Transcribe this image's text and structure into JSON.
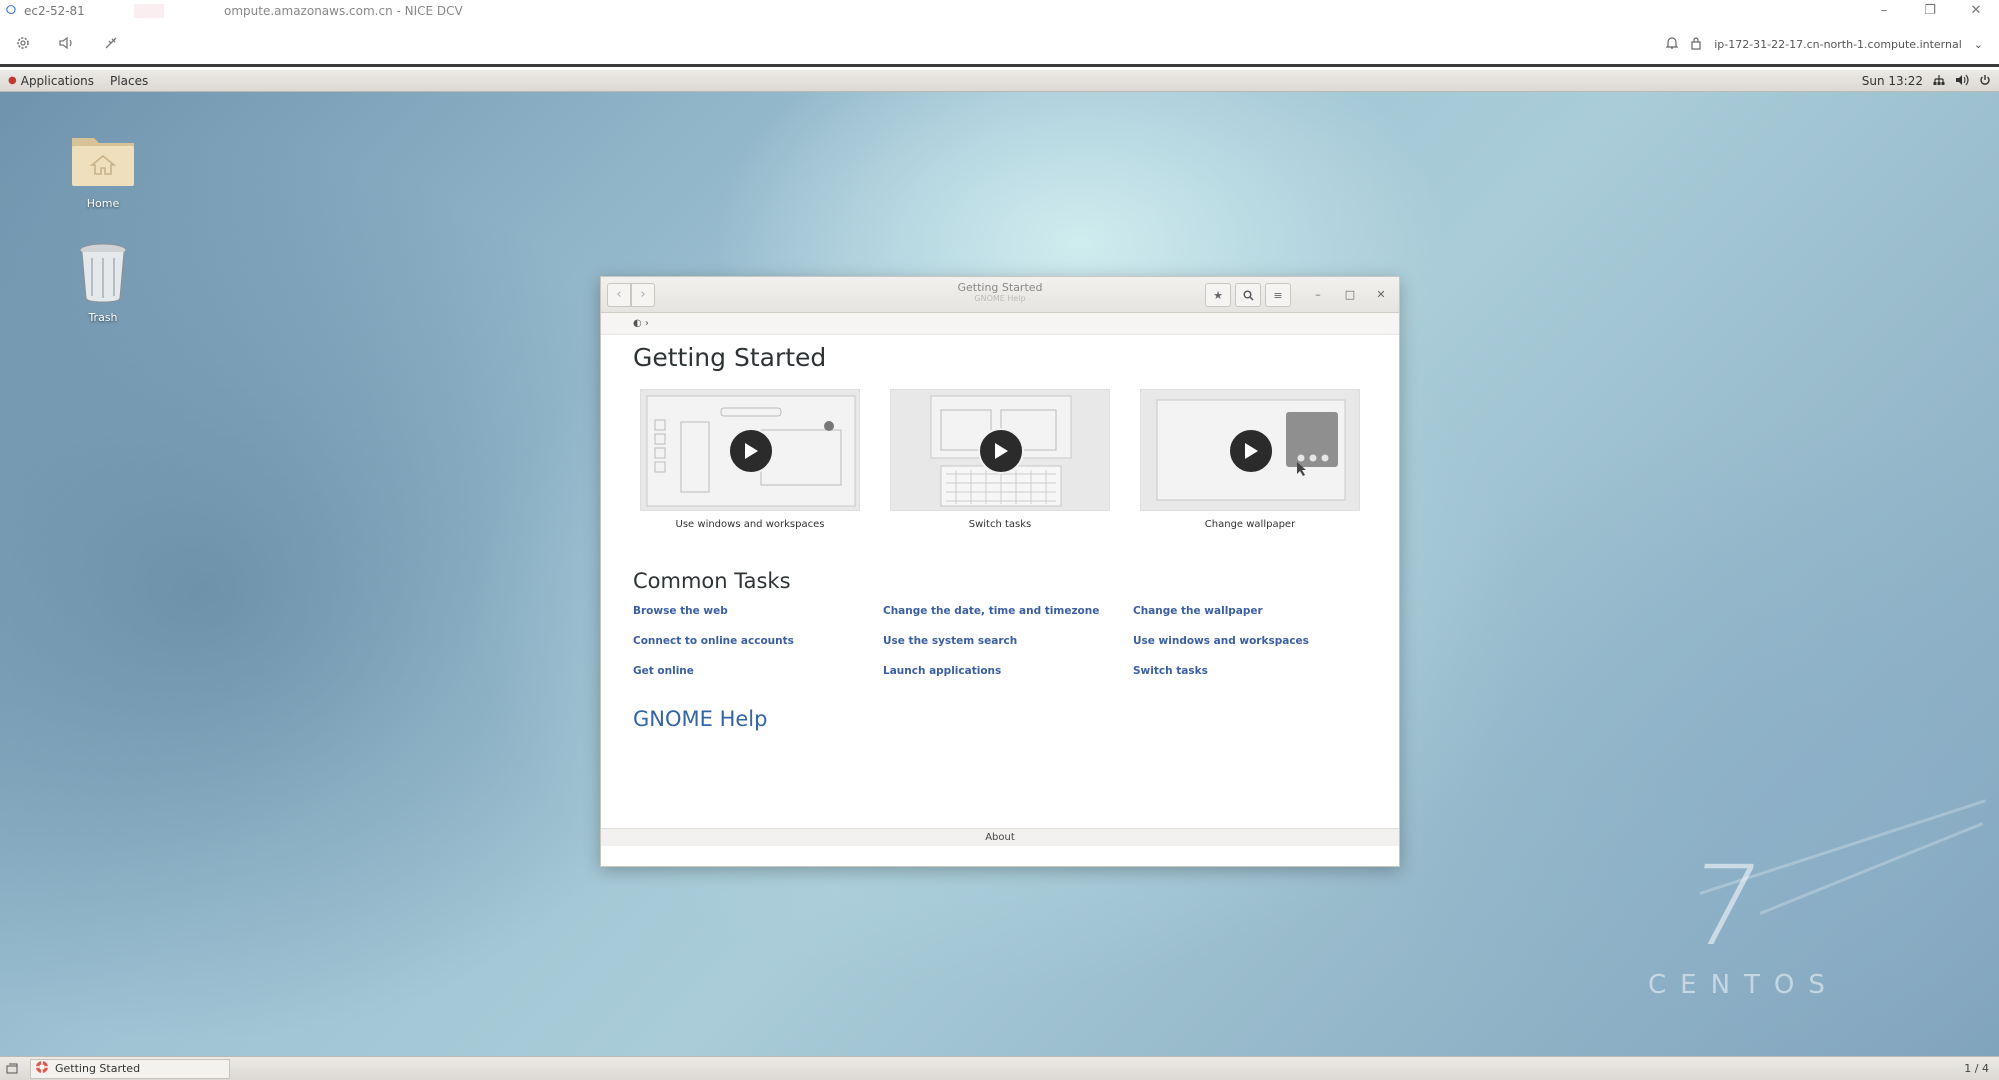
{
  "dcv_client": {
    "tab_label": "ec2-52-81",
    "window_title": "ompute.amazonaws.com.cn - NICE DCV",
    "hostname": "ip-172-31-22-17.cn-north-1.compute.internal"
  },
  "gnome_panel": {
    "applications_label": "Applications",
    "places_label": "Places",
    "clock": "Sun 13:22"
  },
  "desktop": {
    "icons": [
      {
        "label": "Home",
        "icon": "home-folder-icon"
      },
      {
        "label": "Trash",
        "icon": "trash-icon"
      }
    ],
    "watermark_number": "7",
    "watermark_text": "CENTOS"
  },
  "help_window": {
    "title": "Getting Started",
    "subtitle": "GNOME Help",
    "page_heading": "Getting Started",
    "videos": [
      {
        "caption": "Use windows and workspaces"
      },
      {
        "caption": "Switch tasks"
      },
      {
        "caption": "Change wallpaper"
      }
    ],
    "common_tasks_heading": "Common Tasks",
    "tasks": [
      [
        "Browse the web",
        "Change the date, time and timezone",
        "Change the wallpaper"
      ],
      [
        "Connect to online accounts",
        "Use the system search",
        "Use windows and workspaces"
      ],
      [
        "Get online",
        "Launch applications",
        "Switch tasks"
      ]
    ],
    "gnome_help_link": "GNOME Help",
    "footer_label": "About"
  },
  "taskbar": {
    "task_label": "Getting Started",
    "pager": "1 / 4"
  }
}
